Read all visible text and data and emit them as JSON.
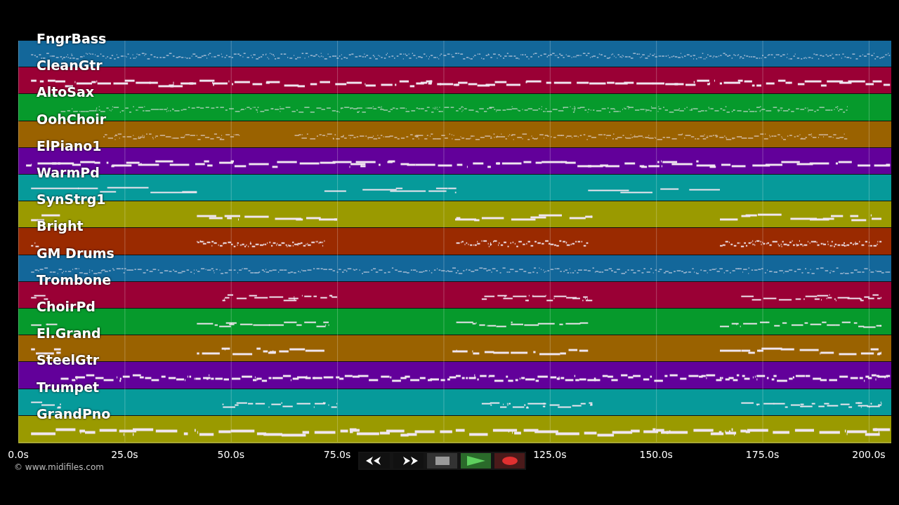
{
  "tracks": [
    {
      "name": "FngrBass",
      "color": "#13679a"
    },
    {
      "name": "CleanGtr",
      "color": "#9a0035"
    },
    {
      "name": "AltoSax",
      "color": "#069a2c"
    },
    {
      "name": "OohChoir",
      "color": "#9a6200"
    },
    {
      "name": "ElPiano1",
      "color": "#62009a"
    },
    {
      "name": "WarmPd",
      "color": "#069a9a"
    },
    {
      "name": "SynStrg1",
      "color": "#9a9a00"
    },
    {
      "name": "Bright",
      "color": "#9a2a00"
    },
    {
      "name": "GM Drums",
      "color": "#13679a"
    },
    {
      "name": "Trombone",
      "color": "#9a0035"
    },
    {
      "name": "ChoirPd",
      "color": "#069a2c"
    },
    {
      "name": "El.Grand",
      "color": "#9a6200"
    },
    {
      "name": "SteelGtr",
      "color": "#62009a"
    },
    {
      "name": "Trumpet",
      "color": "#069a9a"
    },
    {
      "name": "GrandPno",
      "color": "#9a9a00"
    }
  ],
  "time_axis": {
    "ticks_before_controls": [
      "0.0s",
      "25.0s",
      "50.0s",
      "75.0s"
    ],
    "ticks_after_controls": [
      "125.0s",
      "150.0s",
      "175.0s",
      "200.0s"
    ]
  },
  "credit": "© www.midifiles.com",
  "transport": [
    {
      "kind": "rewind"
    },
    {
      "kind": "forward"
    },
    {
      "kind": "stop"
    },
    {
      "kind": "play"
    },
    {
      "kind": "record"
    }
  ]
}
